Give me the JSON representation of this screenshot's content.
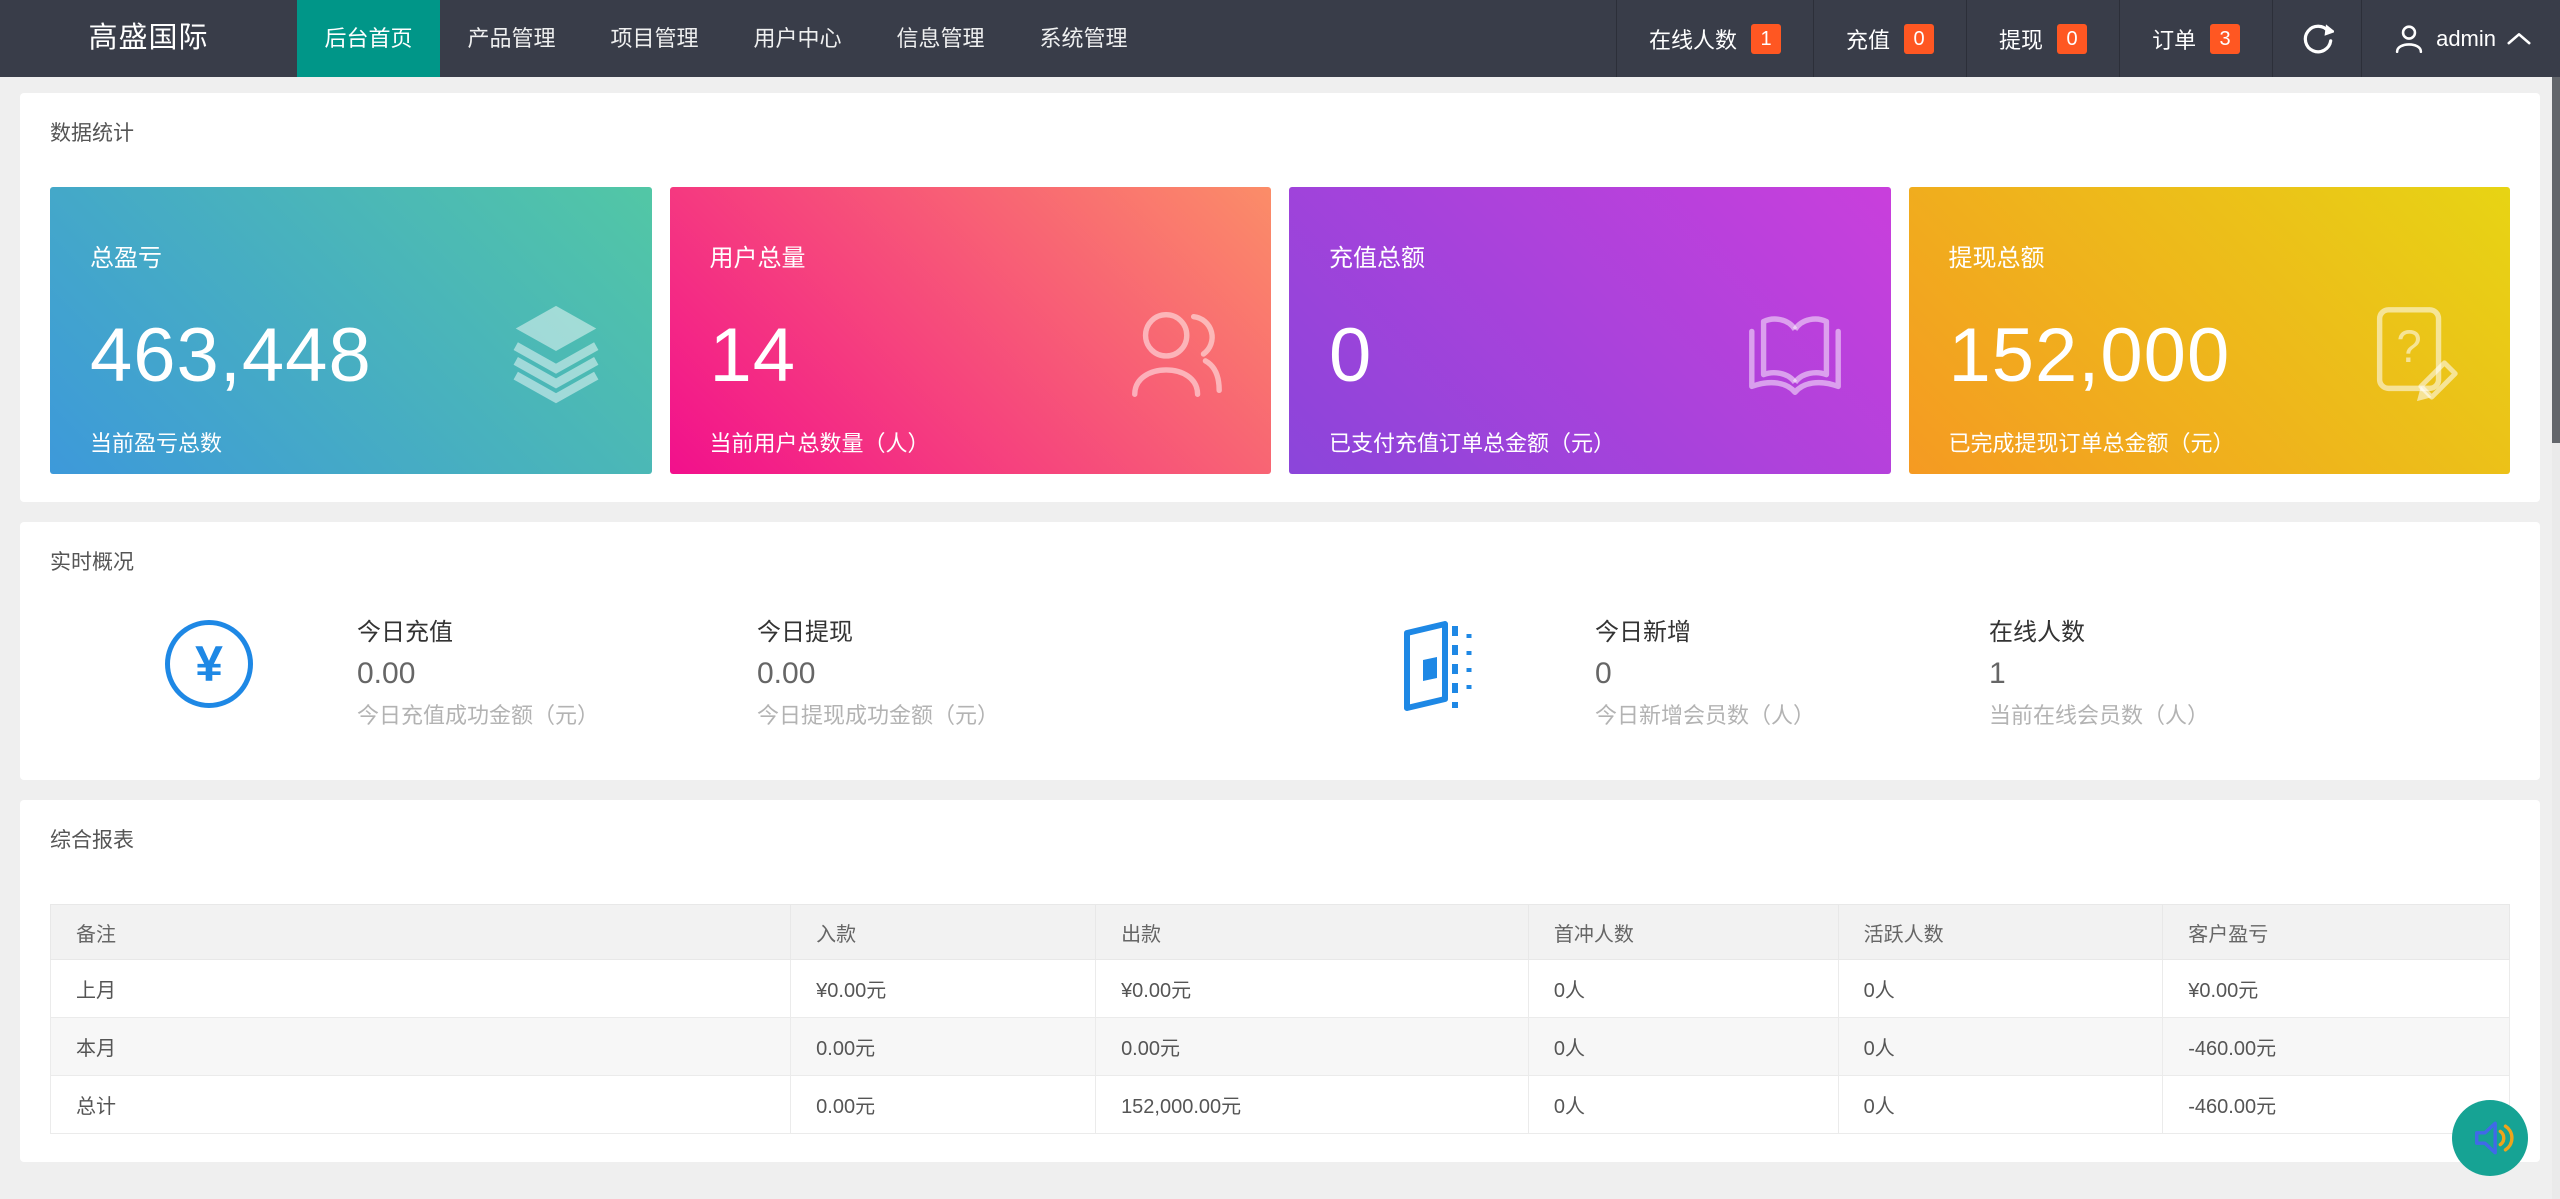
{
  "header": {
    "brand": "高盛国际",
    "nav": [
      {
        "label": "后台首页",
        "active": true
      },
      {
        "label": "产品管理",
        "active": false
      },
      {
        "label": "项目管理",
        "active": false
      },
      {
        "label": "用户中心",
        "active": false
      },
      {
        "label": "信息管理",
        "active": false
      },
      {
        "label": "系统管理",
        "active": false
      }
    ],
    "right_items": [
      {
        "label": "在线人数",
        "badge": "1"
      },
      {
        "label": "充值",
        "badge": "0"
      },
      {
        "label": "提现",
        "badge": "0"
      },
      {
        "label": "订单",
        "badge": "3"
      }
    ],
    "user": "admin"
  },
  "stats_section": {
    "title": "数据统计",
    "cards": [
      {
        "label": "总盈亏",
        "value": "463,448",
        "desc": "当前盈亏总数",
        "icon": "layers-icon",
        "gradient": [
          "#3D99DA",
          "#52C7A5"
        ]
      },
      {
        "label": "用户总量",
        "value": "14",
        "desc": "当前用户总数量（人）",
        "icon": "users-icon",
        "gradient": [
          "#F2108C",
          "#FB8D68"
        ]
      },
      {
        "label": "充值总额",
        "value": "0",
        "desc": "已支付充值订单总金额（元）",
        "icon": "book-icon",
        "gradient": [
          "#8B45DA",
          "#C93FDC"
        ]
      },
      {
        "label": "提现总额",
        "value": "152,000",
        "desc": "已完成提现订单总金额（元）",
        "icon": "doc-edit-icon",
        "gradient": [
          "#F59A22",
          "#E7D414"
        ]
      }
    ]
  },
  "overview_section": {
    "title": "实时概况",
    "stats": [
      {
        "label": "今日充值",
        "value": "0.00",
        "desc": "今日充值成功金额（元）"
      },
      {
        "label": "今日提现",
        "value": "0.00",
        "desc": "今日提现成功金额（元）"
      },
      {
        "label": "今日新增",
        "value": "0",
        "desc": "今日新增会员数（人）"
      },
      {
        "label": "在线人数",
        "value": "1",
        "desc": "当前在线会员数（人）"
      }
    ]
  },
  "report_section": {
    "title": "综合报表",
    "columns": [
      "备注",
      "入款",
      "出款",
      "首冲人数",
      "活跃人数",
      "客户盈亏"
    ],
    "rows": [
      [
        "上月",
        "¥0.00元",
        "¥0.00元",
        "0人",
        "0人",
        "¥0.00元"
      ],
      [
        "本月",
        "0.00元",
        "0.00元",
        "0人",
        "0人",
        "-460.00元"
      ],
      [
        "总计",
        "0.00元",
        "152,000.00元",
        "0人",
        "0人",
        "-460.00元"
      ]
    ]
  },
  "colors": {
    "header_bg": "#393D49",
    "active_tab": "#009688",
    "badge": "#FF5722",
    "icon_blue": "#1E88E5",
    "fab_green": "#16A394"
  }
}
